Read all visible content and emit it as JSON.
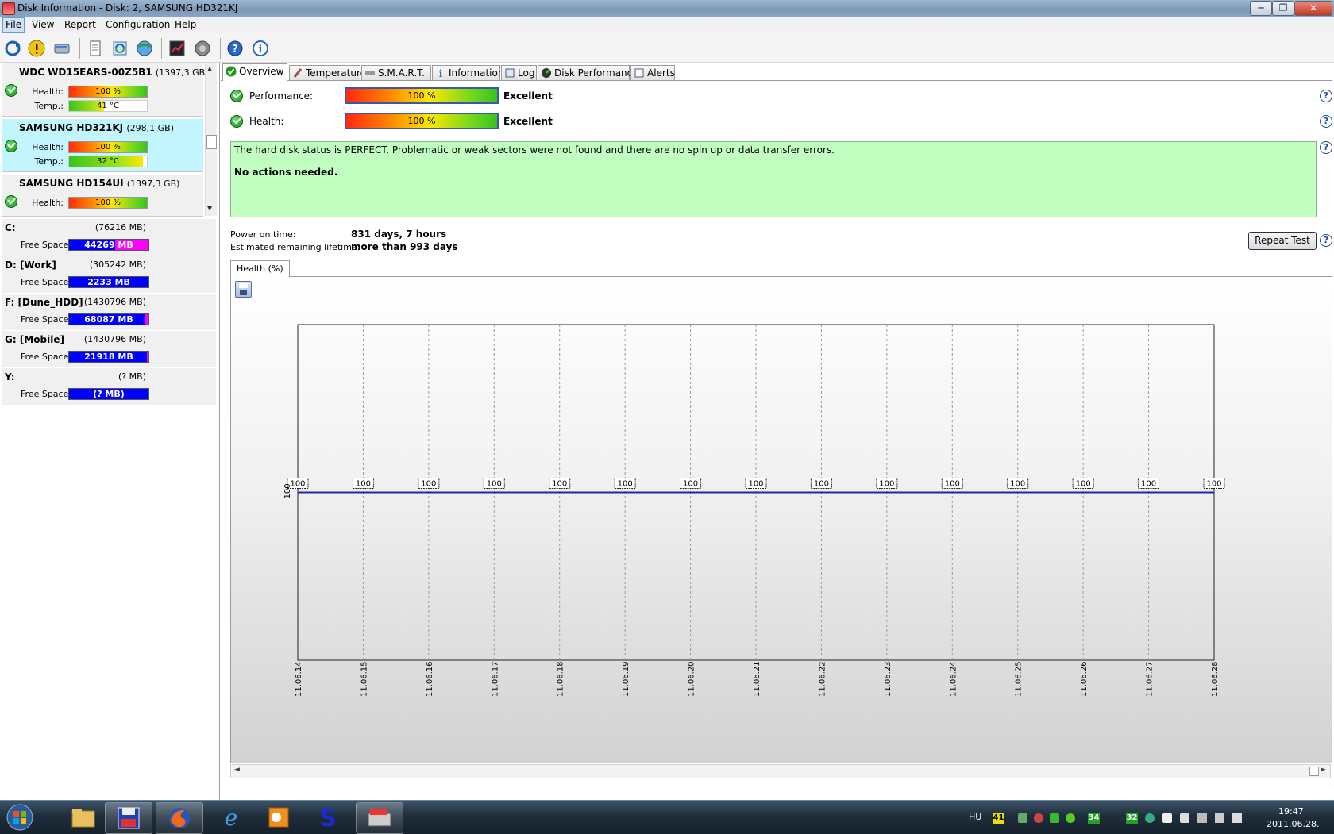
{
  "window": {
    "title": "Disk Information - Disk: 2, SAMSUNG HD321KJ",
    "buttons": [
      "─",
      "❐",
      "✕"
    ]
  },
  "menu": [
    {
      "label": "File",
      "active": true
    },
    {
      "label": "View"
    },
    {
      "label": "Report"
    },
    {
      "label": "Configuration"
    },
    {
      "label": "Help"
    }
  ],
  "toolbar_icons": [
    "refresh-icon",
    "alert-icon",
    "disk-icon",
    "report-icon",
    "sync-icon",
    "network-icon",
    "chart-icon",
    "sound-icon",
    "help-icon",
    "about-icon"
  ],
  "disks": [
    {
      "name": "WDC WD15EARS-00Z5B1",
      "size": "(1397,3 GB)",
      "health_label": "Health:",
      "health": "100 %",
      "temp_label": "Temp.:",
      "temp": "41 °C",
      "temp_fraction": 0.45,
      "selected": false
    },
    {
      "name": "SAMSUNG HD321KJ",
      "size": "(298,1 GB)",
      "health_label": "Health:",
      "health": "100 %",
      "temp_label": "Temp.:",
      "temp": "32 °C",
      "temp_fraction": 0.95,
      "selected": true
    },
    {
      "name": "SAMSUNG HD154UI",
      "size": "(1397,3 GB)",
      "health_label": "Health:",
      "health": "100 %",
      "selected": false
    }
  ],
  "volumes": [
    {
      "name": "C:",
      "size": "(76216 MB)",
      "free_label": "Free Space",
      "free": "44269 MB",
      "used_fraction": 0.42
    },
    {
      "name": "D: [Work]",
      "size": "(305242 MB)",
      "free_label": "Free Space",
      "free": "2233 MB",
      "used_fraction": 0.0
    },
    {
      "name": "F: [Dune_HDD]",
      "size": "(1430796 MB)",
      "free_label": "Free Space",
      "free": "68087 MB",
      "used_fraction": 0.05
    },
    {
      "name": "G: [Mobile]",
      "size": "(1430796 MB)",
      "free_label": "Free Space",
      "free": "21918 MB",
      "used_fraction": 0.02
    },
    {
      "name": "Y:",
      "size": "(? MB)",
      "free_label": "Free Space",
      "free": "(? MB)",
      "used_fraction": 0.0
    }
  ],
  "tabs": [
    {
      "label": "Overview",
      "icon": "check-icon",
      "active": true
    },
    {
      "label": "Temperature",
      "icon": "thermometer-icon"
    },
    {
      "label": "S.M.A.R.T.",
      "icon": "smart-icon"
    },
    {
      "label": "Information",
      "icon": "info-icon"
    },
    {
      "label": "Log",
      "icon": "log-icon"
    },
    {
      "label": "Disk Performance",
      "icon": "speed-icon"
    },
    {
      "label": "Alerts",
      "icon": "alerts-icon"
    }
  ],
  "overview": {
    "performance_label": "Performance:",
    "performance_value": "100 %",
    "performance_rating": "Excellent",
    "health_label": "Health:",
    "health_value": "100 %",
    "health_rating": "Excellent",
    "status_line1": "The hard disk status is PERFECT. Problematic or weak sectors were not found and there are no spin up or data transfer errors.",
    "status_line2": "No actions needed.",
    "power_on_label": "Power on time:",
    "power_on_value": "831 days, 7 hours",
    "lifetime_label": "Estimated remaining lifetime:",
    "lifetime_value": "more than 993 days",
    "repeat_button": "Repeat Test",
    "help_glyph": "?"
  },
  "chart_tab": "Health (%)",
  "chart_data": {
    "type": "line",
    "title": "",
    "xlabel": "",
    "ylabel": "",
    "y_tick": "100",
    "x": [
      "11.06.14",
      "11.06.15",
      "11.06.16",
      "11.06.17",
      "11.06.18",
      "11.06.19",
      "11.06.20",
      "11.06.21",
      "11.06.22",
      "11.06.23",
      "11.06.24",
      "11.06.25",
      "11.06.26",
      "11.06.27",
      "11.06.28"
    ],
    "series": [
      {
        "values": [
          100,
          100,
          100,
          100,
          100,
          100,
          100,
          100,
          100,
          100,
          100,
          100,
          100,
          100,
          100
        ],
        "color": "#1c2aa8"
      }
    ],
    "ylim": [
      0,
      200
    ],
    "grid": "vertical dashed"
  },
  "taskbar": {
    "apps": [
      "start-orb-icon",
      "explorer-icon",
      "disk-app-icon",
      "firefox-icon",
      "ie-icon",
      "outlook-icon",
      "s-app-icon",
      "hdsentinel-icon"
    ],
    "lang": "HU",
    "badges": [
      {
        "text": "41",
        "bg": "#e8e000",
        "fg": "#000"
      },
      {
        "text": "34",
        "bg": "#22a022",
        "fg": "#fff"
      },
      {
        "text": "32",
        "bg": "#22a022",
        "fg": "#fff"
      }
    ],
    "time": "19:47",
    "date": "2011.06.28."
  }
}
